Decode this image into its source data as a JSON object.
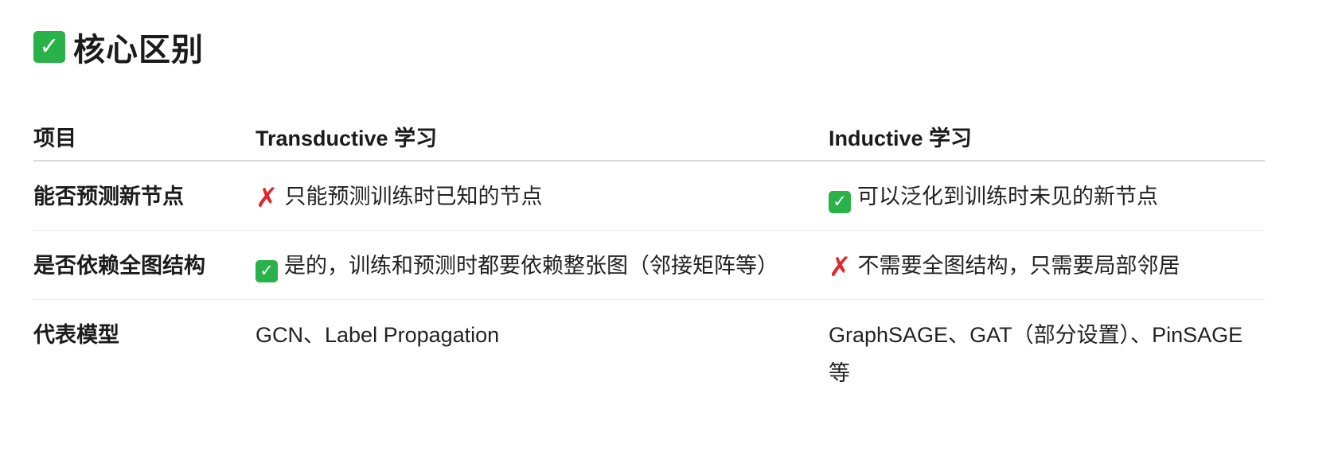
{
  "heading": {
    "icon": "check-mark-icon",
    "title": "核心区别"
  },
  "table": {
    "headers": [
      "项目",
      "Transductive 学习",
      "Inductive 学习"
    ],
    "rows": [
      {
        "label": "能否预测新节点",
        "transductive": {
          "icon": "cross-mark-icon",
          "text": "只能预测训练时已知的节点"
        },
        "inductive": {
          "icon": "check-mark-icon",
          "text": "可以泛化到训练时未见的新节点"
        }
      },
      {
        "label": "是否依赖全图结构",
        "transductive": {
          "icon": "check-mark-icon",
          "text": "是的，训练和预测时都要依赖整张图（邻接矩阵等）"
        },
        "inductive": {
          "icon": "cross-mark-icon",
          "text": "不需要全图结构，只需要局部邻居"
        }
      },
      {
        "label": "代表模型",
        "transductive": {
          "text": "GCN、Label Propagation"
        },
        "inductive": {
          "text": "GraphSAGE、GAT（部分设置）、PinSAGE 等"
        }
      }
    ]
  },
  "colors": {
    "check_green": "#29b14a",
    "cross_red": "#e3262b",
    "text": "#1f1f1f",
    "divider": "#d9d9d9"
  }
}
